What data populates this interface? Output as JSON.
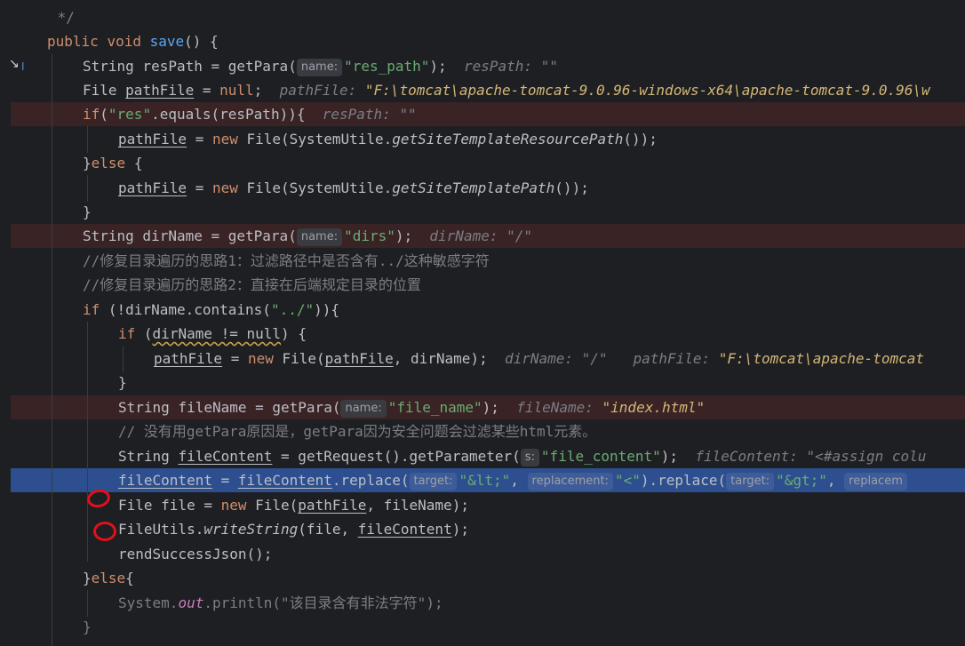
{
  "editor": {
    "lines": [
      {
        "id": "l0",
        "segs": [
          [
            "cm",
            " */"
          ]
        ]
      },
      {
        "id": "l1",
        "segs": [
          [
            "kw",
            "public "
          ],
          [
            "kw",
            "void "
          ],
          [
            "fn",
            "save"
          ],
          [
            "",
            "() {"
          ]
        ]
      },
      {
        "id": "l2",
        "segs": [
          [
            "",
            "String resPath = getPara("
          ],
          [
            "hint",
            "name:"
          ],
          [
            "str",
            "\"res_path\""
          ],
          [
            "",
            ");  "
          ],
          [
            "dbg",
            "resPath: "
          ],
          [
            "dbg-gray",
            "\"\""
          ]
        ]
      },
      {
        "id": "l3",
        "segs": [
          [
            "",
            "File "
          ],
          [
            "ul",
            "pathFile"
          ],
          [
            "",
            " = "
          ],
          [
            "kw",
            "null"
          ],
          [
            "",
            ";  "
          ],
          [
            "dbg",
            "pathFile: "
          ],
          [
            "dbgval",
            "\"F:\\tomcat\\apache-tomcat-9.0.96-windows-x64\\apache-tomcat-9.0.96\\w"
          ]
        ]
      },
      {
        "id": "l4",
        "segs": [
          [
            "kw",
            "if"
          ],
          [
            "",
            "("
          ],
          [
            "str",
            "\"res\""
          ],
          [
            "",
            ".equals(resPath)){  "
          ],
          [
            "dbg",
            "resPath: "
          ],
          [
            "dbg-gray",
            "\"\""
          ]
        ]
      },
      {
        "id": "l5",
        "segs": [
          [
            "ul",
            "pathFile"
          ],
          [
            "",
            " = "
          ],
          [
            "kw",
            "new "
          ],
          [
            "",
            "File(SystemUtile."
          ],
          [
            "it",
            "getSiteTemplateResourcePath"
          ],
          [
            "",
            "());"
          ]
        ]
      },
      {
        "id": "l6",
        "segs": [
          [
            "",
            "}"
          ],
          [
            "kw",
            "else "
          ],
          [
            "",
            "{"
          ]
        ]
      },
      {
        "id": "l7",
        "segs": [
          [
            "ul",
            "pathFile"
          ],
          [
            "",
            " = "
          ],
          [
            "kw",
            "new "
          ],
          [
            "",
            "File(SystemUtile."
          ],
          [
            "it",
            "getSiteTemplatePath"
          ],
          [
            "",
            "());"
          ]
        ]
      },
      {
        "id": "l8",
        "segs": [
          [
            "",
            "}"
          ]
        ]
      },
      {
        "id": "l9",
        "segs": [
          [
            "",
            "String dirName = getPara("
          ],
          [
            "hint",
            "name:"
          ],
          [
            "str",
            "\"dirs\""
          ],
          [
            "",
            ");  "
          ],
          [
            "dbg",
            "dirName: "
          ],
          [
            "dbg-gray",
            "\"/\""
          ]
        ]
      },
      {
        "id": "l10",
        "segs": [
          [
            "cm",
            "//修复目录遍历的思路1：过滤路径中是否含有../这种敏感字符"
          ]
        ]
      },
      {
        "id": "l11",
        "segs": [
          [
            "cm",
            "//修复目录遍历的思路2：直接在后端规定目录的位置"
          ]
        ]
      },
      {
        "id": "l12",
        "segs": [
          [
            "kw",
            "if "
          ],
          [
            "",
            "(!dirName.contains("
          ],
          [
            "str",
            "\"../\""
          ],
          [
            "",
            ")){"
          ]
        ]
      },
      {
        "id": "l13",
        "segs": [
          [
            "kw",
            "if "
          ],
          [
            "",
            "("
          ],
          [
            "warn",
            "dirName != null"
          ],
          [
            "",
            ") {"
          ]
        ]
      },
      {
        "id": "l14",
        "segs": [
          [
            "ul",
            "pathFile"
          ],
          [
            "",
            " = "
          ],
          [
            "kw",
            "new "
          ],
          [
            "",
            "File("
          ],
          [
            "ul",
            "pathFile"
          ],
          [
            "",
            ", dirName);  "
          ],
          [
            "dbg",
            "dirName: "
          ],
          [
            "dbg-gray",
            "\"/\"   "
          ],
          [
            "dbg",
            "pathFile: "
          ],
          [
            "dbgval",
            "\"F:\\tomcat\\apache-tomcat"
          ]
        ]
      },
      {
        "id": "l15",
        "segs": [
          [
            "",
            "}"
          ]
        ]
      },
      {
        "id": "l16",
        "segs": [
          [
            "",
            "String fileName = getPara("
          ],
          [
            "hint",
            "name:"
          ],
          [
            "str",
            "\"file_name\""
          ],
          [
            "",
            ");  "
          ],
          [
            "dbg",
            "fileName: "
          ],
          [
            "dbgval",
            "\"index.html\""
          ]
        ]
      },
      {
        "id": "l17",
        "segs": [
          [
            "cm",
            "// 没有用getPara原因是，getPara因为安全问题会过滤某些html元素。"
          ]
        ]
      },
      {
        "id": "l18",
        "segs": [
          [
            "",
            "String "
          ],
          [
            "ul",
            "fileContent"
          ],
          [
            "",
            " = getRequest().getParameter("
          ],
          [
            "hint",
            "s:"
          ],
          [
            "str",
            "\"file_content\""
          ],
          [
            "",
            ");  "
          ],
          [
            "dbg",
            "fileContent: "
          ],
          [
            "dbg-gray",
            "\"<#assign colu"
          ]
        ]
      },
      {
        "id": "l19",
        "segs": [
          [
            "ul",
            "fileContent"
          ],
          [
            "",
            " = "
          ],
          [
            "ul",
            "fileContent"
          ],
          [
            "",
            ".replace("
          ],
          [
            "hint",
            "target:"
          ],
          [
            "str",
            "\"&lt;\""
          ],
          [
            "",
            ", "
          ],
          [
            "hint",
            "replacement:"
          ],
          [
            "str",
            "\"<\""
          ],
          [
            "",
            ").replace("
          ],
          [
            "hint",
            "target:"
          ],
          [
            "str",
            "\"&gt;\""
          ],
          [
            "",
            ", "
          ],
          [
            "hint",
            "replacem"
          ]
        ]
      },
      {
        "id": "l20",
        "segs": [
          [
            "",
            "File file = "
          ],
          [
            "kw",
            "new "
          ],
          [
            "",
            "File("
          ],
          [
            "ul",
            "pathFile"
          ],
          [
            "",
            ", fileName);"
          ]
        ]
      },
      {
        "id": "l21",
        "segs": [
          [
            "",
            "FileUtils."
          ],
          [
            "it",
            "writeString"
          ],
          [
            "",
            "(file, "
          ],
          [
            "ul",
            "fileContent"
          ],
          [
            "",
            ");"
          ]
        ]
      },
      {
        "id": "l22",
        "segs": [
          [
            "",
            "rendSuccessJson();"
          ]
        ]
      },
      {
        "id": "l23",
        "segs": [
          [
            "",
            "}"
          ],
          [
            "kw",
            "else"
          ],
          [
            "",
            "{"
          ]
        ]
      },
      {
        "id": "l24",
        "segs": [
          [
            "cm",
            "System."
          ],
          [
            "fld",
            "out"
          ],
          [
            "cm",
            ".println("
          ],
          [
            "cm",
            "\"该目录含有非法字符\""
          ],
          [
            "cm",
            ");"
          ]
        ]
      },
      {
        "id": "l25",
        "segs": [
          [
            "cm",
            "}"
          ]
        ]
      }
    ]
  },
  "colors": {
    "background": "#1e1f22",
    "breakpoint_line": "#3a2325",
    "current_line": "#2d4f8f",
    "keyword": "#cf8e6d",
    "string": "#6aab73",
    "annotation_mark": "#e2101a"
  },
  "icons": {
    "exec_arrow": "execution-point-icon",
    "text_cursor": "text-cursor-icon"
  }
}
